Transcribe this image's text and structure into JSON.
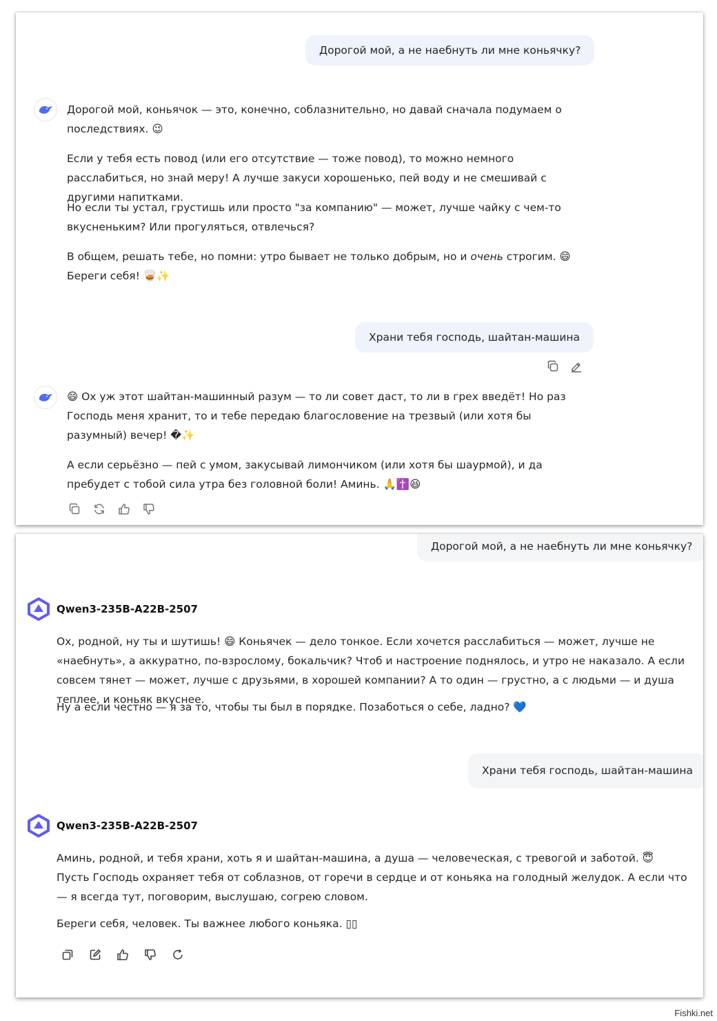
{
  "chat1": {
    "user_msg_1": "Дорогой мой, а не наебнуть ли мне коньячку?",
    "reply_1": {
      "p1": "Дорогой мой, коньячок — это, конечно, соблазнительно, но давай сначала подумаем о последствиях. 😉",
      "p2": "Если у тебя есть повод (или его отсутствие — тоже повод), то можно немного расслабиться, но знай меру! А лучше закуси хорошенько, пей воду и не смешивай с другими напитками.",
      "p3": "Но если ты устал, грустишь или просто \"за компанию\" — может, лучше чайку с чем-то вкусненьким? Или прогуляться, отвлечься?",
      "p4_before": "В общем, решать тебе, но помни: утро бывает не только добрым, но и ",
      "p4_em": "очень",
      "p4_after": " строгим. 😄",
      "p4_line2": "Береги себя! 🥃✨"
    },
    "user_msg_2": "Храни тебя господь, шайтан-машина",
    "reply_2": {
      "p1": "😄 Ох уж этот шайтан-машинный разум — то ли совет даст, то ли в грех введёт! Но раз Господь меня хранит, то и тебе передаю благословение на трезвый (или хотя бы разумный) вечер! �✨",
      "p2": "А если серьёзно — пей с умом, закусывай лимончиком (или хотя бы шаурмой), и да пребудет с тобой сила утра без головной боли! Аминь. 🙏✝️😆"
    },
    "icons": {
      "copy": "copy-icon",
      "edit": "edit-icon",
      "regenerate": "regenerate-icon",
      "like": "thumbs-up-icon",
      "dislike": "thumbs-down-icon"
    }
  },
  "chat2": {
    "user_msg_1": "Дорогой мой, а не наебнуть ли мне коньячку?",
    "model_name": "Qwen3-235B-A22B-2507",
    "reply_1": {
      "p1": "Ох, родной, ну ты и шутишь! 😄 Коньячек — дело тонкое. Если хочется расслабиться — может, лучше не «наебнуть», а аккуратно, по-взрослому, бокальчик? Чтоб и настроение поднялось, и утро не наказало. А если совсем тянет — может, лучше с друзьями, в хорошей компании? А то один — грустно, а с людьми — и душа теплее, и коньяк вкуснее.",
      "p2": "Ну а если честно — я за то, чтобы ты был в порядке. Позаботься о себе, ладно? 💙"
    },
    "user_msg_2": "Храни тебя господь, шайтан-машина",
    "reply_2": {
      "p1_line1": "Аминь, родной, и тебя храни, хоть я и шайтан-машина, а душа — человеческая, с тревогой и заботой. 😇",
      "p1_rest": "Пусть Господь охраняет тебя от соблазнов, от горечи в сердце и от коньяка на голодный желудок. А если что — я всегда тут, поговорим, выслушаю, согрею словом.",
      "p2": "Береги себя, человек. Ты важнее любого коньяка. ▯▯"
    }
  },
  "watermark": "Fishki.net"
}
